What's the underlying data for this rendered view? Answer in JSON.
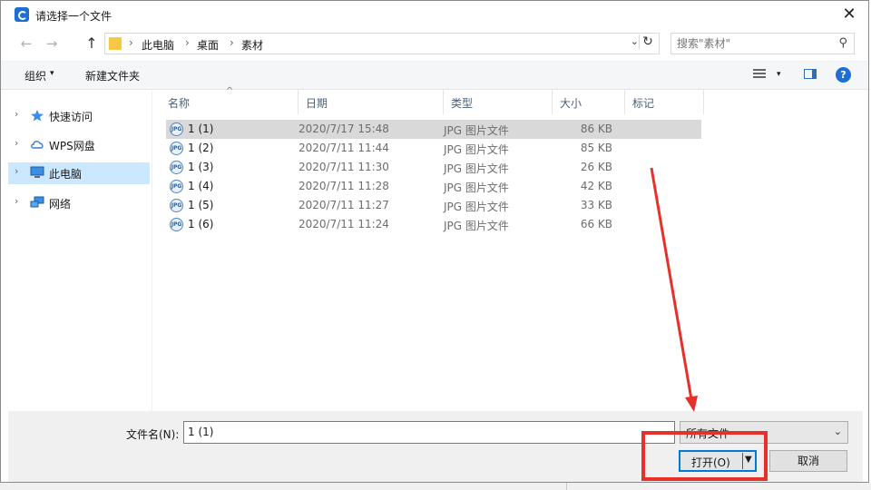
{
  "window": {
    "title": "请选择一个文件",
    "close_glyph": "✕"
  },
  "nav": {
    "back_glyph": "←",
    "forward_glyph": "→",
    "up_glyph": "↑"
  },
  "address": {
    "crumbs": [
      "此电脑",
      "桌面",
      "素材"
    ],
    "separator": "›",
    "dropdown_glyph": "⌄",
    "refresh_glyph": "↻"
  },
  "search": {
    "placeholder": "搜索\"素材\"",
    "icon_glyph": "⚲"
  },
  "toolbar": {
    "organize_label": "组织",
    "caret": "▾",
    "new_folder_label": "新建文件夹",
    "help_label": "?"
  },
  "sidebar": {
    "items": [
      {
        "label": "快速访问",
        "icon": "star-icon",
        "selected": false
      },
      {
        "label": "WPS网盘",
        "icon": "cloud-icon",
        "selected": false
      },
      {
        "label": "此电脑",
        "icon": "computer-icon",
        "selected": true
      },
      {
        "label": "网络",
        "icon": "network-icon",
        "selected": false
      }
    ],
    "chevron": "›"
  },
  "columns": [
    "名称",
    "日期",
    "类型",
    "大小",
    "标记"
  ],
  "sort_indicator": "^",
  "file_icon_text": "JPG",
  "files": [
    {
      "name": "1 (1)",
      "date": "2020/7/17 15:48",
      "type": "JPG 图片文件",
      "size": "86 KB",
      "selected": true
    },
    {
      "name": "1 (2)",
      "date": "2020/7/11 11:44",
      "type": "JPG 图片文件",
      "size": "85 KB",
      "selected": false
    },
    {
      "name": "1 (3)",
      "date": "2020/7/11 11:30",
      "type": "JPG 图片文件",
      "size": "26 KB",
      "selected": false
    },
    {
      "name": "1 (4)",
      "date": "2020/7/11 11:28",
      "type": "JPG 图片文件",
      "size": "42 KB",
      "selected": false
    },
    {
      "name": "1 (5)",
      "date": "2020/7/11 11:27",
      "type": "JPG 图片文件",
      "size": "33 KB",
      "selected": false
    },
    {
      "name": "1 (6)",
      "date": "2020/7/11 11:24",
      "type": "JPG 图片文件",
      "size": "66 KB",
      "selected": false
    }
  ],
  "footer": {
    "filename_label": "文件名(N):",
    "filename_value": "1 (1)",
    "filetype_value": "所有文件",
    "open_label": "打开(O)",
    "open_arrow": "▼",
    "cancel_label": "取消"
  },
  "annotation": {
    "color": "#e8302a"
  }
}
